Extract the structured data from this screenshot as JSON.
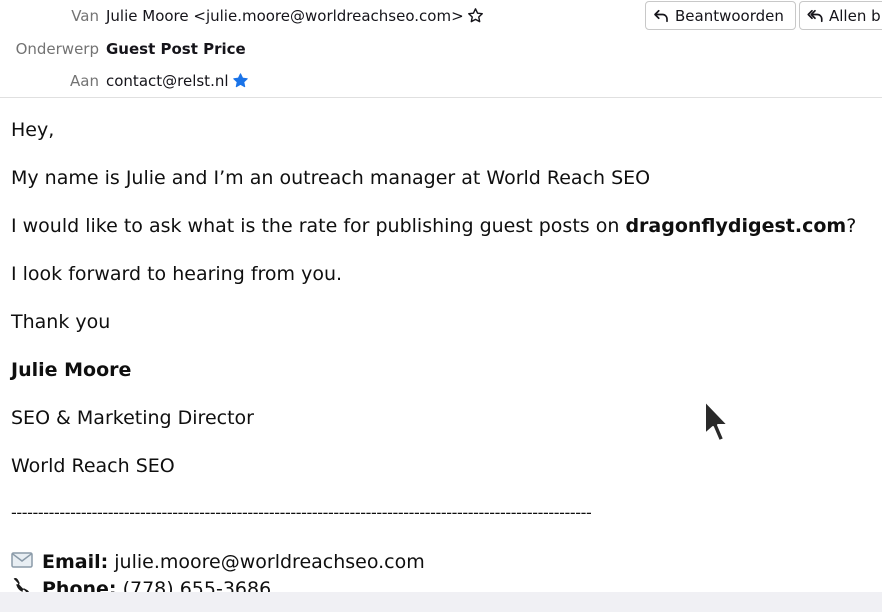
{
  "header": {
    "from_label": "Van",
    "from_value": "Julie Moore <julie.moore@worldreachseo.com>",
    "subject_label": "Onderwerp",
    "subject_value": "Guest Post Price",
    "to_label": "Aan",
    "to_value": "contact@relst.nl",
    "reply_label": "Beantwoorden",
    "reply_all_label": "Allen b",
    "from_star_icon": "star-outline-icon",
    "to_star_icon": "star-filled-icon",
    "to_star_color": "#1a73e8"
  },
  "message": {
    "greeting": "Hey,",
    "line1": "My name is Julie and I’m an outreach manager at World Reach SEO",
    "line2_before": "I would like to ask what is the rate for publishing guest posts on ",
    "line2_bold": "dragonflydigest.com",
    "line2_after": "?",
    "line3": "I look forward to hearing from you.",
    "line4": "Thank you",
    "sig_name": "Julie Moore",
    "sig_title": "SEO & Marketing Director",
    "sig_company": "World Reach SEO",
    "separator": "------------------------------------------------------------------------------------------------------------",
    "email_label": "Email:",
    "email_value": "julie.moore@worldreachseo.com",
    "phone_label": "Phone:",
    "phone_value": "(778) 655-3686"
  }
}
